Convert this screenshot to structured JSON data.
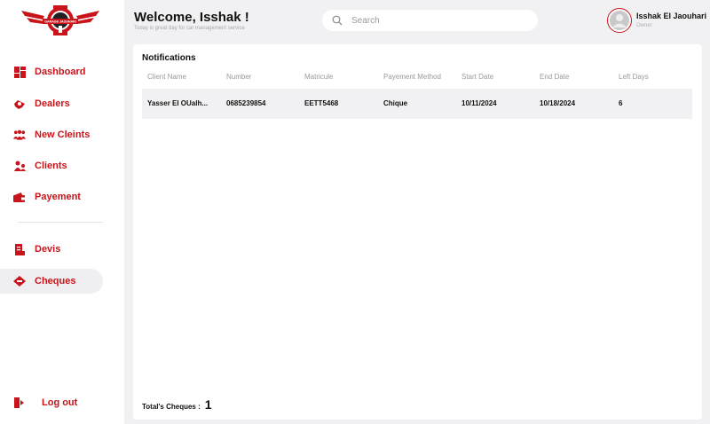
{
  "logo": {
    "text": "GARAGE JAOUHARI"
  },
  "sidebar": {
    "items": [
      {
        "label": "Dashboard",
        "icon": "dashboard-icon"
      },
      {
        "label": "Dealers",
        "icon": "dealers-icon"
      },
      {
        "label": "New Cleints",
        "icon": "new-clients-icon"
      },
      {
        "label": "Clients",
        "icon": "clients-icon"
      },
      {
        "label": "Payement",
        "icon": "payment-icon"
      },
      {
        "label": "Devis",
        "icon": "devis-icon"
      },
      {
        "label": "Cheques",
        "icon": "cheques-icon",
        "active": true
      }
    ],
    "logout": "Log out"
  },
  "header": {
    "welcome": "Welcome, Isshak !",
    "subtitle": "Today is great day for car management service",
    "search_placeholder": "Search",
    "user_name": "Isshak El Jaouhari",
    "user_role": "Owner"
  },
  "notifications": {
    "title": "Notifications",
    "columns": [
      "Client Name",
      "Number",
      "Matricule",
      "Payement Method",
      "Start Date",
      "End Date",
      "Left Days"
    ],
    "rows": [
      [
        "Yasser El OUalh...",
        "0685239854",
        "EETT5468",
        "Chique",
        "10/11/2024",
        "10/18/2024",
        "6"
      ]
    ],
    "total_label": "Total's Cheques :",
    "total_count": "1"
  },
  "colors": {
    "accent": "#c8141a",
    "background": "#f1f1f3",
    "row_bg": "#f1f1f3"
  }
}
